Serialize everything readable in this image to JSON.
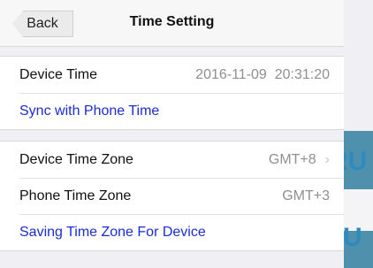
{
  "background": {
    "fragment_top": "RU",
    "fragment_bottom": "U"
  },
  "navbar": {
    "back_label": "Back",
    "title": "Time Setting"
  },
  "device_time": {
    "label": "Device Time",
    "value": "2016-11-09  20:31:20"
  },
  "sync_label": "Sync with Phone Time",
  "device_time_zone": {
    "label": "Device Time Zone",
    "value": "GMT+8"
  },
  "phone_time_zone": {
    "label": "Phone Time Zone",
    "value": "GMT+3"
  },
  "saving_label": "Saving Time Zone For Device",
  "colors": {
    "link": "#1a2cd6",
    "value_gray": "#8e8e93",
    "background_blue": "#4f90ad"
  }
}
